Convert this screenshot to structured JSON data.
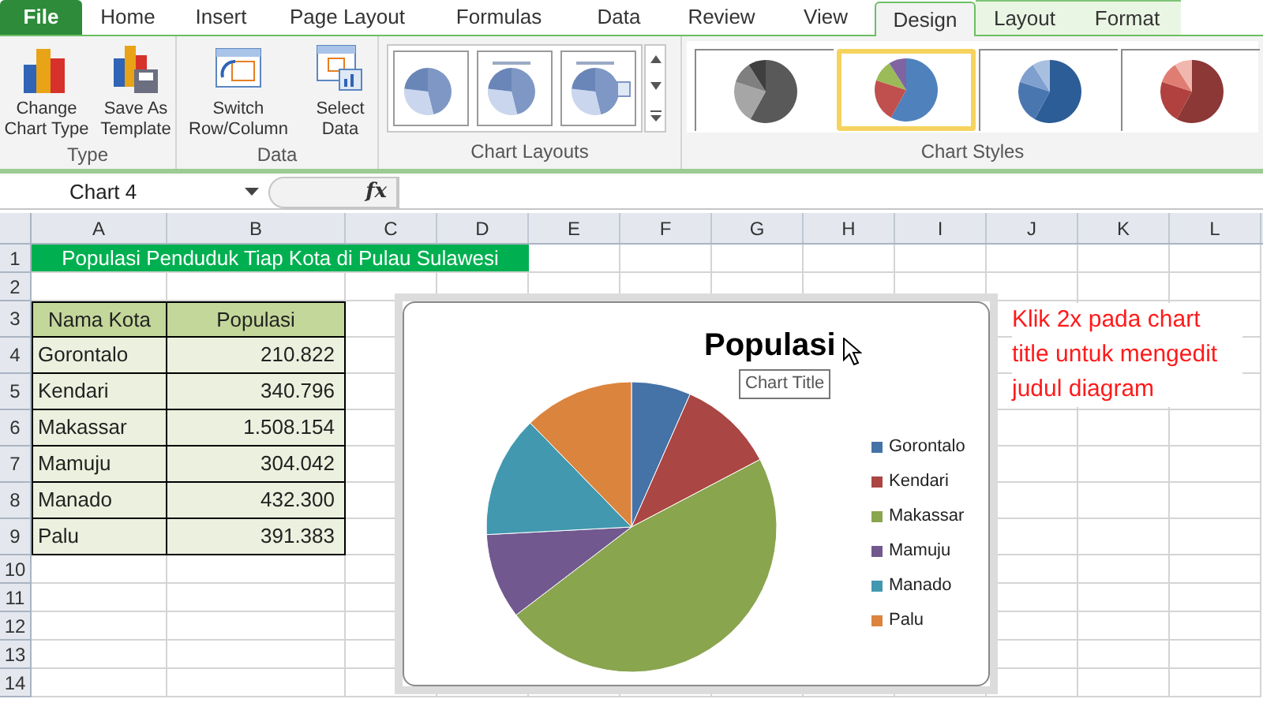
{
  "ribbon": {
    "tabs": [
      {
        "label": "File",
        "kind": "file",
        "selected": false
      },
      {
        "label": "Home",
        "kind": "normal",
        "selected": false
      },
      {
        "label": "Insert",
        "kind": "normal",
        "selected": false
      },
      {
        "label": "Page Layout",
        "kind": "normal",
        "selected": false
      },
      {
        "label": "Formulas",
        "kind": "normal",
        "selected": false
      },
      {
        "label": "Data",
        "kind": "normal",
        "selected": false
      },
      {
        "label": "Review",
        "kind": "normal",
        "selected": false
      },
      {
        "label": "View",
        "kind": "normal",
        "selected": false
      },
      {
        "label": "Design",
        "kind": "contextual",
        "selected": true
      },
      {
        "label": "Layout",
        "kind": "contextual",
        "selected": false
      },
      {
        "label": "Format",
        "kind": "contextual",
        "selected": false
      }
    ],
    "groups": [
      {
        "label": "Type",
        "buttons": [
          {
            "kind": "change",
            "lines": [
              "Change",
              "Chart Type"
            ]
          },
          {
            "kind": "save",
            "lines": [
              "Save As",
              "Template"
            ]
          }
        ]
      },
      {
        "label": "Data",
        "buttons": [
          {
            "kind": "switch",
            "lines": [
              "Switch",
              "Row/Column"
            ]
          },
          {
            "kind": "select",
            "lines": [
              "Select",
              "Data"
            ]
          }
        ]
      }
    ],
    "chart_layouts": {
      "label": "Chart Layouts",
      "items": [
        {
          "kind": "plain"
        },
        {
          "kind": "title"
        },
        {
          "kind": "percent"
        }
      ]
    },
    "chart_styles": {
      "label": "Chart Styles",
      "items": [
        {
          "kind": "gray",
          "selected": false
        },
        {
          "kind": "multi",
          "selected": true
        },
        {
          "kind": "blue",
          "selected": false
        },
        {
          "kind": "red",
          "selected": false
        }
      ]
    }
  },
  "formula_bar": {
    "name_box": "Chart 4",
    "function_label": "fx"
  },
  "sheet": {
    "columns": [
      "A",
      "B",
      "C",
      "D",
      "E",
      "F",
      "G",
      "H",
      "I",
      "J",
      "K",
      "L"
    ],
    "rows": [
      "1",
      "2",
      "3",
      "4",
      "5",
      "6",
      "7",
      "8",
      "9",
      "10",
      "11",
      "12",
      "13",
      "14"
    ],
    "title": "Populasi Penduduk Tiap Kota di Pulau Sulawesi",
    "table": {
      "columns": [
        "Nama Kota",
        "Populasi"
      ],
      "rows": [
        [
          "Gorontalo",
          "210.822"
        ],
        [
          "Kendari",
          "340.796"
        ],
        [
          "Makassar",
          "1.508.154"
        ],
        [
          "Mamuju",
          "304.042"
        ],
        [
          "Manado",
          "432.300"
        ],
        [
          "Palu",
          "391.383"
        ]
      ]
    }
  },
  "chart": {
    "title": "Populasi",
    "tooltip": "Chart Title",
    "chart_data": {
      "type": "pie",
      "categories": [
        "Gorontalo",
        "Kendari",
        "Makassar",
        "Mamuju",
        "Manado",
        "Palu"
      ],
      "values": [
        6.61,
        10.69,
        47.32,
        9.54,
        13.56,
        12.28
      ],
      "colors": [
        "#4572a7",
        "#aa4643",
        "#89a54e",
        "#71588f",
        "#4198af",
        "#db843d"
      ]
    }
  },
  "note": "Klik 2x pada chart title untuk mengedit judul diagram"
}
